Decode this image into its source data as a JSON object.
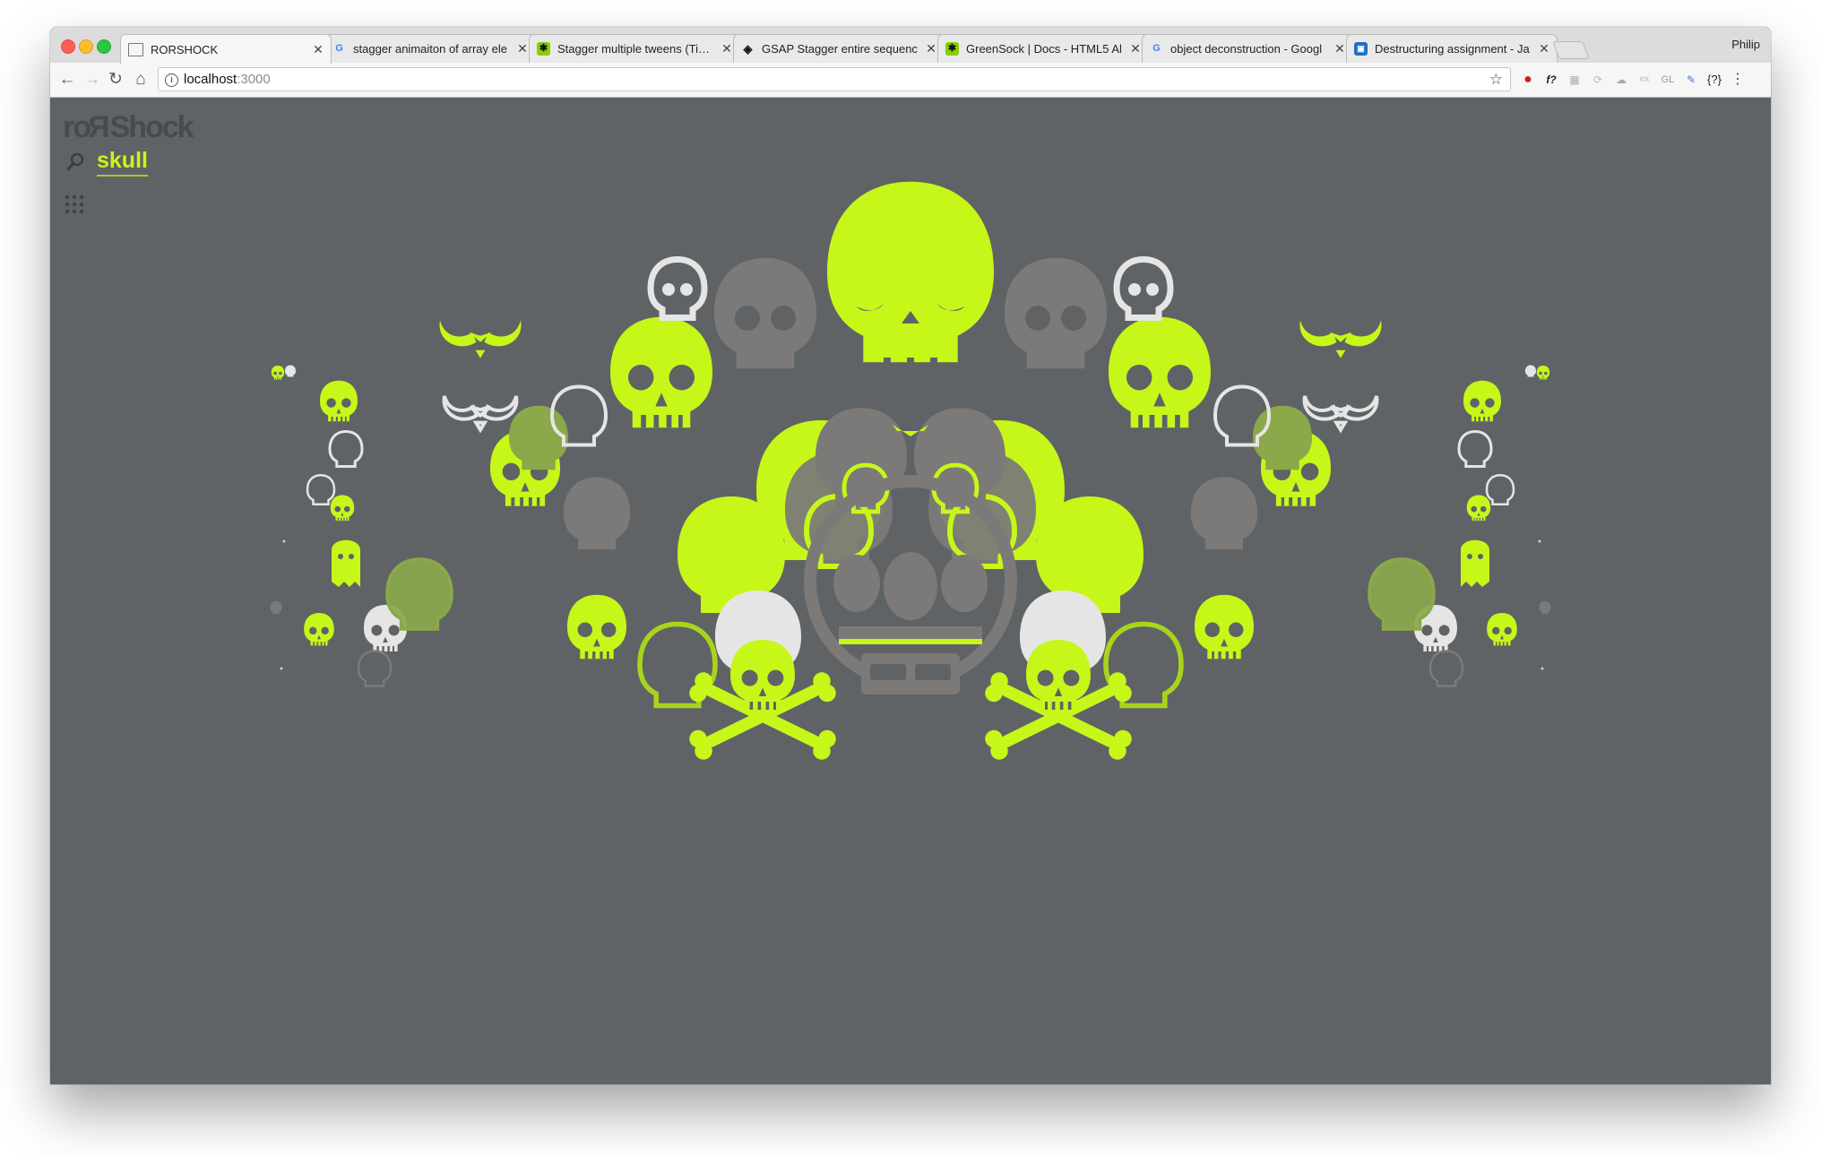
{
  "window": {
    "profile_name": "Philip",
    "tabs": [
      {
        "title": "RORSHOCK",
        "favicon": "page-icon",
        "active": true
      },
      {
        "title": "stagger animaiton of array ele",
        "favicon": "google-icon",
        "active": false
      },
      {
        "title": "Stagger multiple tweens (Time",
        "favicon": "greensock-icon",
        "active": false
      },
      {
        "title": "GSAP Stagger entire sequenc",
        "favicon": "codepen-icon",
        "active": false
      },
      {
        "title": "GreenSock | Docs - HTML5 Al",
        "favicon": "greensock-icon",
        "active": false
      },
      {
        "title": "object deconstruction - Googl",
        "favicon": "google-icon",
        "active": false
      },
      {
        "title": "Destructuring assignment - Ja",
        "favicon": "mdn-icon",
        "active": false
      }
    ]
  },
  "toolbar": {
    "url_host": "localhost",
    "url_port": ":3000",
    "extensions": [
      "pinterest-icon",
      "f?",
      "grid-ext-icon",
      "sync-ext-icon",
      "cloud-ext-icon",
      "ex",
      "GL",
      "dropper-ext-icon",
      "{?}",
      "menu-icon"
    ]
  },
  "page": {
    "logo_left": "ro",
    "logo_mirror": "R",
    "logo_right": "Shock",
    "search_term": "skull"
  },
  "colors": {
    "background": "#5f6366",
    "lime": "#c6f719",
    "lime_dark": "#a9d41c",
    "olive": "#8ba84a",
    "gray": "#7b7a78",
    "gray_light": "#8d8c8a",
    "white": "#e5e5e5"
  }
}
